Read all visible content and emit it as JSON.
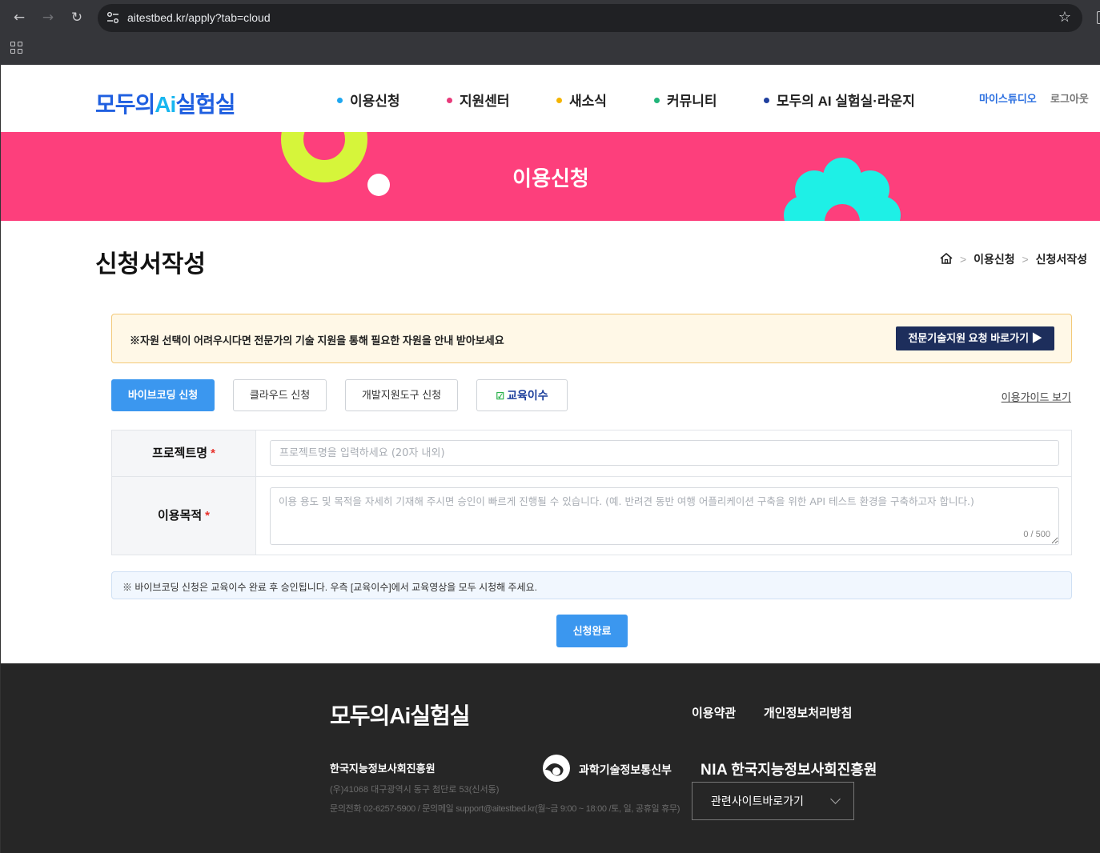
{
  "browser": {
    "url": "aitestbed.kr/apply?tab=cloud",
    "back_icon": "arrow-left-icon",
    "forward_icon": "arrow-right-icon",
    "reload_icon": "reload-icon",
    "bookmark_icon": "star-icon",
    "apps_icon": "apps-grid-icon"
  },
  "header": {
    "logo_text_1": "모두의",
    "logo_text_ai": "Ai",
    "logo_text_2": "실험실",
    "nav": [
      {
        "label": "이용신청",
        "dot_color": "#1ea7f0"
      },
      {
        "label": "지원센터",
        "dot_color": "#e83a7a"
      },
      {
        "label": "새소식",
        "dot_color": "#f4b400"
      },
      {
        "label": "커뮤니티",
        "dot_color": "#21b57a"
      },
      {
        "label": "모두의 AI 실험실·라운지",
        "dot_color": "#1f3f9f"
      }
    ],
    "util_studio": "마이스튜디오",
    "util_logout": "로그아웃"
  },
  "banner": {
    "title": "이용신청",
    "bg_color": "#fd3f7c"
  },
  "page": {
    "title": "신청서작성",
    "breadcrumb": [
      "이용신청",
      "신청서작성"
    ],
    "home_icon": "home-icon"
  },
  "notice": {
    "text": "※자원 선택이 어려우시다면 전문가의 기술 지원을 통해 필요한 자원을 안내 받아보세요",
    "button": "전문기술지원 요청 바로가기 ▶"
  },
  "tabs": [
    {
      "label": "바이브코딩 신청",
      "active": true
    },
    {
      "label": "클라우드 신청",
      "active": false
    },
    {
      "label": "개발지원도구 신청",
      "active": false
    },
    {
      "label": "교육이수",
      "active": false,
      "check": "☑"
    }
  ],
  "guide_link": "이용가이드 보기",
  "form": {
    "project_label": "프로젝트명",
    "project_placeholder": "프로젝트명을 입력하세요 (20자 내외)",
    "purpose_label": "이용목적",
    "purpose_placeholder": "이용 용도 및 목적을 자세히 기재해 주시면 승인이 빠르게 진행될 수 있습니다. (예. 반려견 동반 여행 어플리케이션 구축을 위한 API 테스트 환경을 구축하고자 합니다.)",
    "required_mark": "*",
    "counter": "0 / 500"
  },
  "info_note": "※ 바이브코딩 신청은 교육이수 완료 후 승인됩니다. 우측 [교육이수]에서 교육영상을 모두 시청해 주세요.",
  "submit_label": "신청완료",
  "footer": {
    "logo_text": "모두의Ai실험실",
    "links": [
      "이용약관",
      "개인정보처리방침"
    ],
    "org": "한국지능정보사회진흥원",
    "address": "(우)41068 대구광역시 동구 첨단로 53(신서동)",
    "contact": "문의전화 02-6257-5900 / 문의메일 support@aitestbed.kr(월~금 9:00 ~ 18:00 /토, 일, 공휴일 휴무)",
    "msit_text": "과학기술정보통신부",
    "nia_abbr": "NIA",
    "nia_name": "한국지능정보사회진흥원",
    "related_select": "관련사이트바로가기"
  }
}
